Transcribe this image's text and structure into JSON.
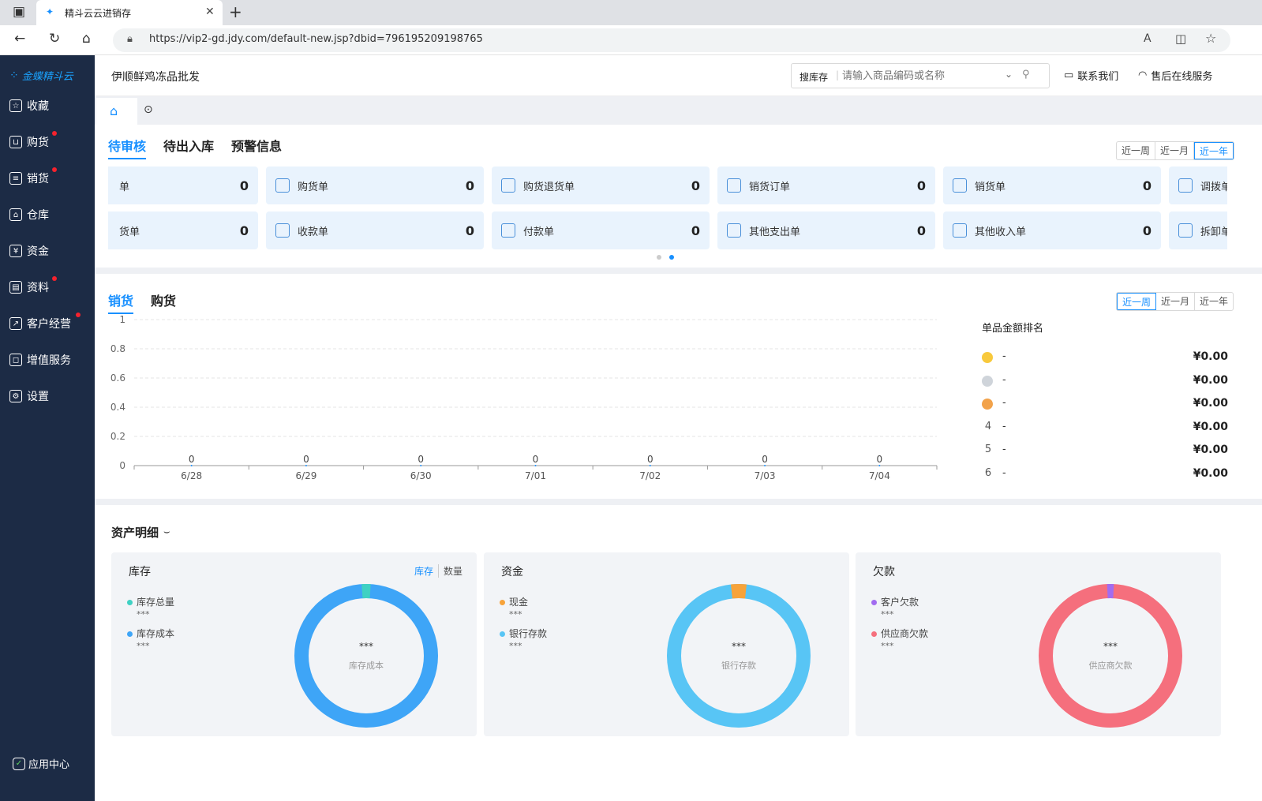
{
  "browser": {
    "tab_title": "精斗云云进销存",
    "url": "https://vip2-gd.jdy.com/default-new.jsp?dbid=796195209198765"
  },
  "sidebar": {
    "logo_text": "金蝶精斗云",
    "items": [
      {
        "label": "收藏",
        "icon": "star-icon",
        "dot": false
      },
      {
        "label": "购货",
        "icon": "cart-icon",
        "dot": true
      },
      {
        "label": "销货",
        "icon": "sales-icon",
        "dot": true
      },
      {
        "label": "仓库",
        "icon": "warehouse-icon",
        "dot": false
      },
      {
        "label": "资金",
        "icon": "yen-icon",
        "dot": false
      },
      {
        "label": "资料",
        "icon": "document-icon",
        "dot": true
      },
      {
        "label": "客户经营",
        "icon": "chart-icon",
        "dot": true
      },
      {
        "label": "增值服务",
        "icon": "service-icon",
        "dot": false
      },
      {
        "label": "设置",
        "icon": "gear-icon",
        "dot": false
      }
    ],
    "app_center": "应用中心"
  },
  "header": {
    "company": "伊顺鲜鸡冻品批发",
    "search_scope": "搜库存",
    "search_placeholder": "请输入商品编码或名称",
    "contact": "联系我们",
    "after_sales": "售后在线服务"
  },
  "pending": {
    "tabs": [
      "待审核",
      "待出入库",
      "预警信息"
    ],
    "periods": [
      "近一周",
      "近一月",
      "近一年"
    ],
    "active_period": 2,
    "row1": [
      {
        "label": "单",
        "count": "0"
      },
      {
        "label": "购货单",
        "count": "0"
      },
      {
        "label": "购货退货单",
        "count": "0"
      },
      {
        "label": "销货订单",
        "count": "0"
      },
      {
        "label": "销货单",
        "count": "0"
      },
      {
        "label": "调拨单",
        "count": ""
      }
    ],
    "row2": [
      {
        "label": "货单",
        "count": "0"
      },
      {
        "label": "收款单",
        "count": "0"
      },
      {
        "label": "付款单",
        "count": "0"
      },
      {
        "label": "其他支出单",
        "count": "0"
      },
      {
        "label": "其他收入单",
        "count": "0"
      },
      {
        "label": "拆卸单",
        "count": ""
      }
    ]
  },
  "trend": {
    "tabs": [
      "销货",
      "购货"
    ],
    "periods": [
      "近一周",
      "近一月",
      "近一年"
    ],
    "active_period": 0,
    "ranking_title": "单品金额排名",
    "ranking": [
      {
        "rank": "1",
        "name": "-",
        "amount": "¥0.00"
      },
      {
        "rank": "2",
        "name": "-",
        "amount": "¥0.00"
      },
      {
        "rank": "3",
        "name": "-",
        "amount": "¥0.00"
      },
      {
        "rank": "4",
        "name": "-",
        "amount": "¥0.00"
      },
      {
        "rank": "5",
        "name": "-",
        "amount": "¥0.00"
      },
      {
        "rank": "6",
        "name": "-",
        "amount": "¥0.00"
      }
    ]
  },
  "chart_data": {
    "type": "line",
    "categories": [
      "6/28",
      "6/29",
      "6/30",
      "7/01",
      "7/02",
      "7/03",
      "7/04"
    ],
    "series": [
      {
        "values": [
          0,
          0,
          0,
          0,
          0,
          0,
          0
        ]
      }
    ],
    "yticks": [
      "0",
      "0.2",
      "0.4",
      "0.6",
      "0.8",
      "1"
    ],
    "ylim": [
      0,
      1
    ],
    "grid": true
  },
  "assets": {
    "title": "资产明细",
    "cards": [
      {
        "title": "库存",
        "toggles": [
          "库存",
          "数量"
        ],
        "legend": [
          {
            "label": "库存总量",
            "value": "***",
            "color": "#3fd1c3"
          },
          {
            "label": "库存成本",
            "value": "***",
            "color": "#3ea5f7"
          }
        ],
        "center_value": "***",
        "center_label": "库存成本",
        "ring_main": "#3ea5f7",
        "ring_minor": "#3fd1c3",
        "minor_fraction": 0.02
      },
      {
        "title": "资金",
        "toggles": [],
        "legend": [
          {
            "label": "现金",
            "value": "***",
            "color": "#f7a33a"
          },
          {
            "label": "银行存款",
            "value": "***",
            "color": "#58c5f5"
          }
        ],
        "center_value": "***",
        "center_label": "银行存款",
        "ring_main": "#58c5f5",
        "ring_minor": "#f7a33a",
        "minor_fraction": 0.035
      },
      {
        "title": "欠款",
        "toggles": [],
        "legend": [
          {
            "label": "客户欠款",
            "value": "***",
            "color": "#a26cf0"
          },
          {
            "label": "供应商欠款",
            "value": "***",
            "color": "#f56f7d"
          }
        ],
        "center_value": "***",
        "center_label": "供应商欠款",
        "ring_main": "#f56f7d",
        "ring_minor": "#a26cf0",
        "minor_fraction": 0.015
      }
    ]
  }
}
